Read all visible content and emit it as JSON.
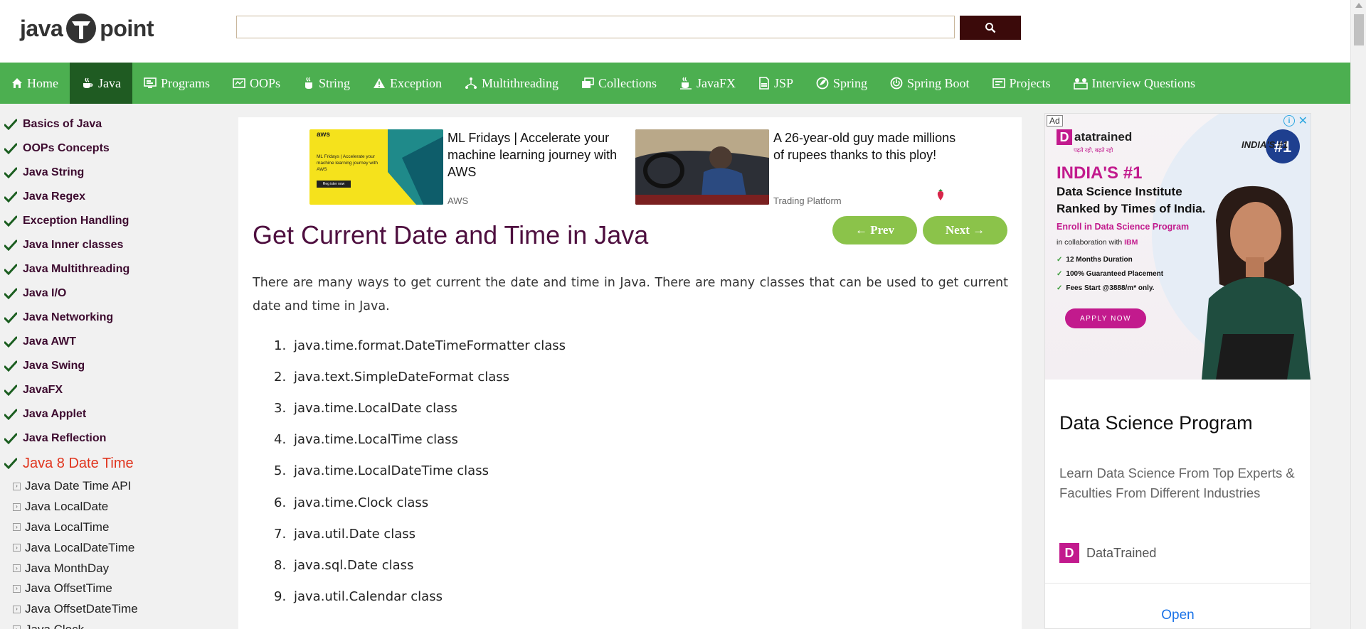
{
  "header": {
    "logo_left": "java",
    "logo_right": "point",
    "search_placeholder": "",
    "search_value": ""
  },
  "nav": {
    "items": [
      {
        "label": "Home",
        "icon": "home-icon"
      },
      {
        "label": "Java",
        "icon": "java-cup-icon",
        "active": true
      },
      {
        "label": "Programs",
        "icon": "programs-icon"
      },
      {
        "label": "OOPs",
        "icon": "oops-icon"
      },
      {
        "label": "String",
        "icon": "string-icon"
      },
      {
        "label": "Exception",
        "icon": "warning-icon"
      },
      {
        "label": "Multithreading",
        "icon": "multithreading-icon"
      },
      {
        "label": "Collections",
        "icon": "collections-icon"
      },
      {
        "label": "JavaFX",
        "icon": "javafx-icon"
      },
      {
        "label": "JSP",
        "icon": "jsp-icon"
      },
      {
        "label": "Spring",
        "icon": "spring-icon"
      },
      {
        "label": "Spring Boot",
        "icon": "power-icon"
      },
      {
        "label": "Projects",
        "icon": "projects-icon"
      },
      {
        "label": "Interview Questions",
        "icon": "interview-icon"
      }
    ]
  },
  "sidebar": {
    "topics": [
      "Basics of Java",
      "OOPs Concepts",
      "Java String",
      "Java Regex",
      "Exception Handling",
      "Java Inner classes",
      "Java Multithreading",
      "Java I/O",
      "Java Networking",
      "Java AWT",
      "Java Swing",
      "JavaFX",
      "Java Applet",
      "Java Reflection"
    ],
    "current": "Java 8 Date Time",
    "subtopics": [
      "Java Date Time API",
      "Java LocalDate",
      "Java LocalTime",
      "Java LocalDateTime",
      "Java MonthDay",
      "Java OffsetTime",
      "Java OffsetDateTime",
      "Java Clock"
    ]
  },
  "ads_top": [
    {
      "title": "ML Fridays | Accelerate your machine learning journey with AWS",
      "source": "AWS",
      "image_text": "ML Fridays | Accelerate your machine learning journey with AWS",
      "image_button": "Reg ister now",
      "logo": "aws"
    },
    {
      "title": "A 26-year-old guy made millions of rupees thanks to this ploy!",
      "source": "Trading Platform"
    }
  ],
  "main": {
    "title": "Get Current Date and Time in Java",
    "prev_label": "← Prev",
    "next_label": "Next →",
    "intro": "There are many ways to get current the date and time in Java. There are many classes that can be used to get current date and time in Java.",
    "classes": [
      "java.time.format.DateTimeFormatter class",
      "java.text.SimpleDateFormat class",
      "java.time.LocalDate class",
      "java.time.LocalTime class",
      "java.time.LocalDateTime class",
      "java.time.Clock class",
      "java.util.Date class",
      "java.sql.Date class",
      "java.util.Calendar class"
    ]
  },
  "right_ad": {
    "ad_label": "Ad",
    "brand": "atatrained",
    "brand_initial": "D",
    "brand_tagline": "पढ़ते रहो, बढ़ते रहो",
    "badge": "INDIA'S #1",
    "headline": "INDIA'S #1",
    "line1": "Data Science Institute",
    "line2": "Ranked by Times of India.",
    "line3": "Enroll in Data Science Program",
    "line4_pre": "in collaboration with ",
    "line4_brand": "IBM",
    "bullets": [
      "12 Months Duration",
      "100% Guaranteed Placement",
      "Fees Start @3888/m* only."
    ],
    "apply": "APPLY NOW",
    "title": "Data Science Program",
    "desc": "Learn Data Science From Top Experts & Faculties From Different Industries",
    "advertiser": "DataTrained",
    "open": "Open"
  },
  "colors": {
    "nav_bg": "#4caf50",
    "nav_active": "#1f5b22",
    "title": "#4e0f3f",
    "sidebar_current": "#e0341d",
    "pill": "#8bc34a",
    "search_button": "#3b0a0a",
    "ad_accent": "#c21a8d"
  }
}
